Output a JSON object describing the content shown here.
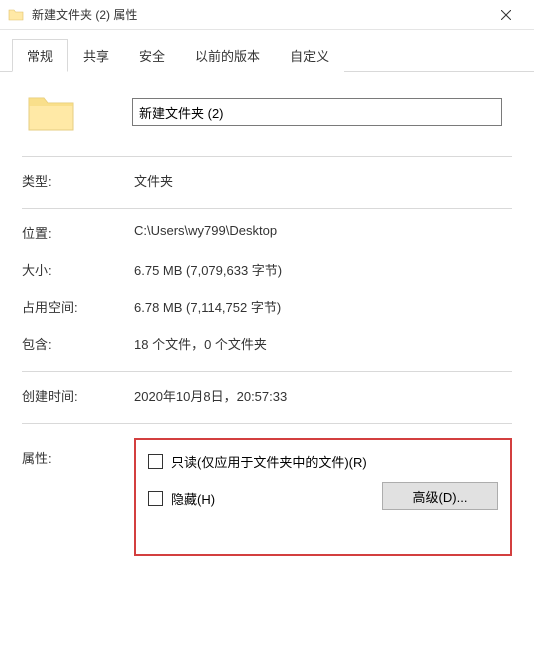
{
  "title": "新建文件夹 (2) 属性",
  "tabs": {
    "general": "常规",
    "share": "共享",
    "security": "安全",
    "previous": "以前的版本",
    "custom": "自定义"
  },
  "folder_name": "新建文件夹 (2)",
  "labels": {
    "type": "类型:",
    "location": "位置:",
    "size": "大小:",
    "size_on_disk": "占用空间:",
    "contains": "包含:",
    "created": "创建时间:",
    "attributes": "属性:"
  },
  "values": {
    "type": "文件夹",
    "location": "C:\\Users\\wy799\\Desktop",
    "size": "6.75 MB (7,079,633 字节)",
    "size_on_disk": "6.78 MB (7,114,752 字节)",
    "contains": "18 个文件，0 个文件夹",
    "created": "2020年10月8日，20:57:33"
  },
  "attr": {
    "readonly_label": "只读(仅应用于文件夹中的文件)(R)",
    "hidden_label": "隐藏(H)",
    "advanced_label": "高级(D)..."
  }
}
